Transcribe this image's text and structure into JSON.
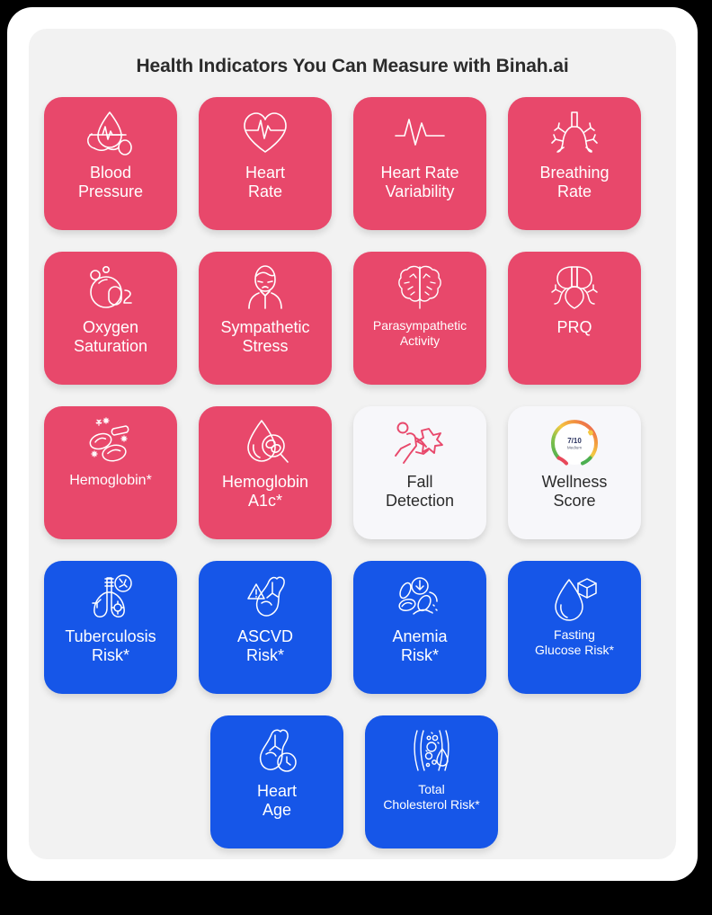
{
  "page": {
    "title": "Health Indicators You Can Measure with Binah.ai",
    "background_color": "#000000",
    "frame_color": "#ffffff",
    "panel_color": "#f2f2f2",
    "title_color": "#2b2b2b"
  },
  "colors": {
    "pink": "#e8486b",
    "blue": "#1656e8",
    "light": "#f7f7fa",
    "white": "#ffffff",
    "gauge_red": "#e8485a",
    "gauge_orange": "#f2953f",
    "gauge_yellow": "#f5c842",
    "gauge_green": "#4caf50",
    "gauge_text": "#2d3561"
  },
  "rows": [
    {
      "cards": [
        {
          "label": "Blood\nPressure",
          "line1": "Blood",
          "line2": "Pressure",
          "style": "pink",
          "size": "normal",
          "icon": "blood-pressure-icon"
        },
        {
          "label": "Heart\nRate",
          "line1": "Heart",
          "line2": "Rate",
          "style": "pink",
          "size": "normal",
          "icon": "heart-pulse-icon"
        },
        {
          "label": "Heart Rate\nVariability",
          "line1": "Heart Rate",
          "line2": "Variability",
          "style": "pink",
          "size": "normal",
          "icon": "waveform-icon"
        },
        {
          "label": "Breathing\nRate",
          "line1": "Breathing",
          "line2": "Rate",
          "style": "pink",
          "size": "normal",
          "icon": "bronchi-icon"
        }
      ]
    },
    {
      "cards": [
        {
          "label": "Oxygen\nSaturation",
          "line1": "Oxygen",
          "line2": "Saturation",
          "style": "pink",
          "size": "normal",
          "icon": "oxygen-bubbles-icon"
        },
        {
          "label": "Sympathetic\nStress",
          "line1": "Sympathetic",
          "line2": "Stress",
          "style": "pink",
          "size": "normal",
          "icon": "stressed-person-icon"
        },
        {
          "label": "Parasympathetic\nActivity",
          "line1": "Parasympathetic",
          "line2": "Activity",
          "style": "pink",
          "size": "small",
          "icon": "brain-icon"
        },
        {
          "label": "PRQ",
          "line1": "PRQ",
          "line2": "",
          "style": "pink",
          "size": "normal",
          "icon": "lungs-heart-icon"
        }
      ]
    },
    {
      "cards": [
        {
          "label": "Hemoglobin*",
          "line1": "Hemoglobin*",
          "line2": "",
          "style": "pink",
          "size": "mid",
          "icon": "blood-cells-icon"
        },
        {
          "label": "Hemoglobin\nA1c*",
          "line1": "Hemoglobin",
          "line2": "A1c*",
          "style": "pink",
          "size": "normal",
          "icon": "blood-drop-magnifier-icon"
        },
        {
          "label": "Fall\nDetection",
          "line1": "Fall",
          "line2": "Detection",
          "style": "light",
          "size": "normal",
          "icon": "falling-person-icon"
        },
        {
          "label": "Wellness\nScore",
          "line1": "Wellness",
          "line2": "Score",
          "style": "light",
          "size": "normal",
          "icon": "wellness-gauge-icon"
        }
      ]
    },
    {
      "cards": [
        {
          "label": "Tuberculosis\nRisk*",
          "line1": "Tuberculosis",
          "line2": "Risk*",
          "style": "blue",
          "size": "normal",
          "icon": "lungs-bacteria-icon"
        },
        {
          "label": "ASCVD\nRisk*",
          "line1": "ASCVD",
          "line2": "Risk*",
          "style": "blue",
          "size": "normal",
          "icon": "heart-warning-icon"
        },
        {
          "label": "Anemia\nRisk*",
          "line1": "Anemia",
          "line2": "Risk*",
          "style": "blue",
          "size": "normal",
          "icon": "anemia-cells-icon"
        },
        {
          "label": "Fasting\nGlucose Risk*",
          "line1": "Fasting",
          "line2": "Glucose Risk*",
          "style": "blue",
          "size": "small",
          "icon": "glucose-drop-icon"
        }
      ]
    },
    {
      "center": true,
      "cards": [
        {
          "label": "Heart\nAge",
          "line1": "Heart",
          "line2": "Age",
          "style": "blue",
          "size": "normal",
          "icon": "heart-clock-icon"
        },
        {
          "label": "Total\nCholesterol Risk*",
          "line1": "Total",
          "line2": "Cholesterol Risk*",
          "style": "blue",
          "size": "small",
          "icon": "artery-cholesterol-icon"
        }
      ]
    }
  ],
  "wellness_gauge": {
    "score": "7/10",
    "level": "Medium"
  }
}
